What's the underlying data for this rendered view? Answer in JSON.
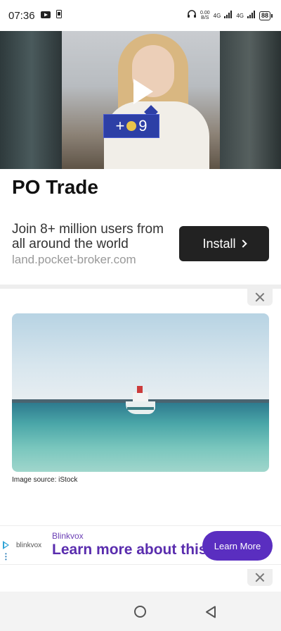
{
  "status_bar": {
    "time": "07:36",
    "net_speed_value": "0.00",
    "net_speed_unit": "B/S",
    "net_type_1": "4G",
    "net_type_2": "4G",
    "battery": "88"
  },
  "ad_video": {
    "coin_prefix": "+",
    "coin_count": "9"
  },
  "ad_card": {
    "title": "PO Trade",
    "description": "Join 8+ million users from all around the world",
    "url": "land.pocket-broker.com",
    "install_label": "Install"
  },
  "article": {
    "image_source": "Image source:  iStock"
  },
  "banner_ad": {
    "logo_text": "blinkvox",
    "brand": "Blinkvox",
    "headline": "Learn more about this",
    "cta_label": "Learn More"
  }
}
